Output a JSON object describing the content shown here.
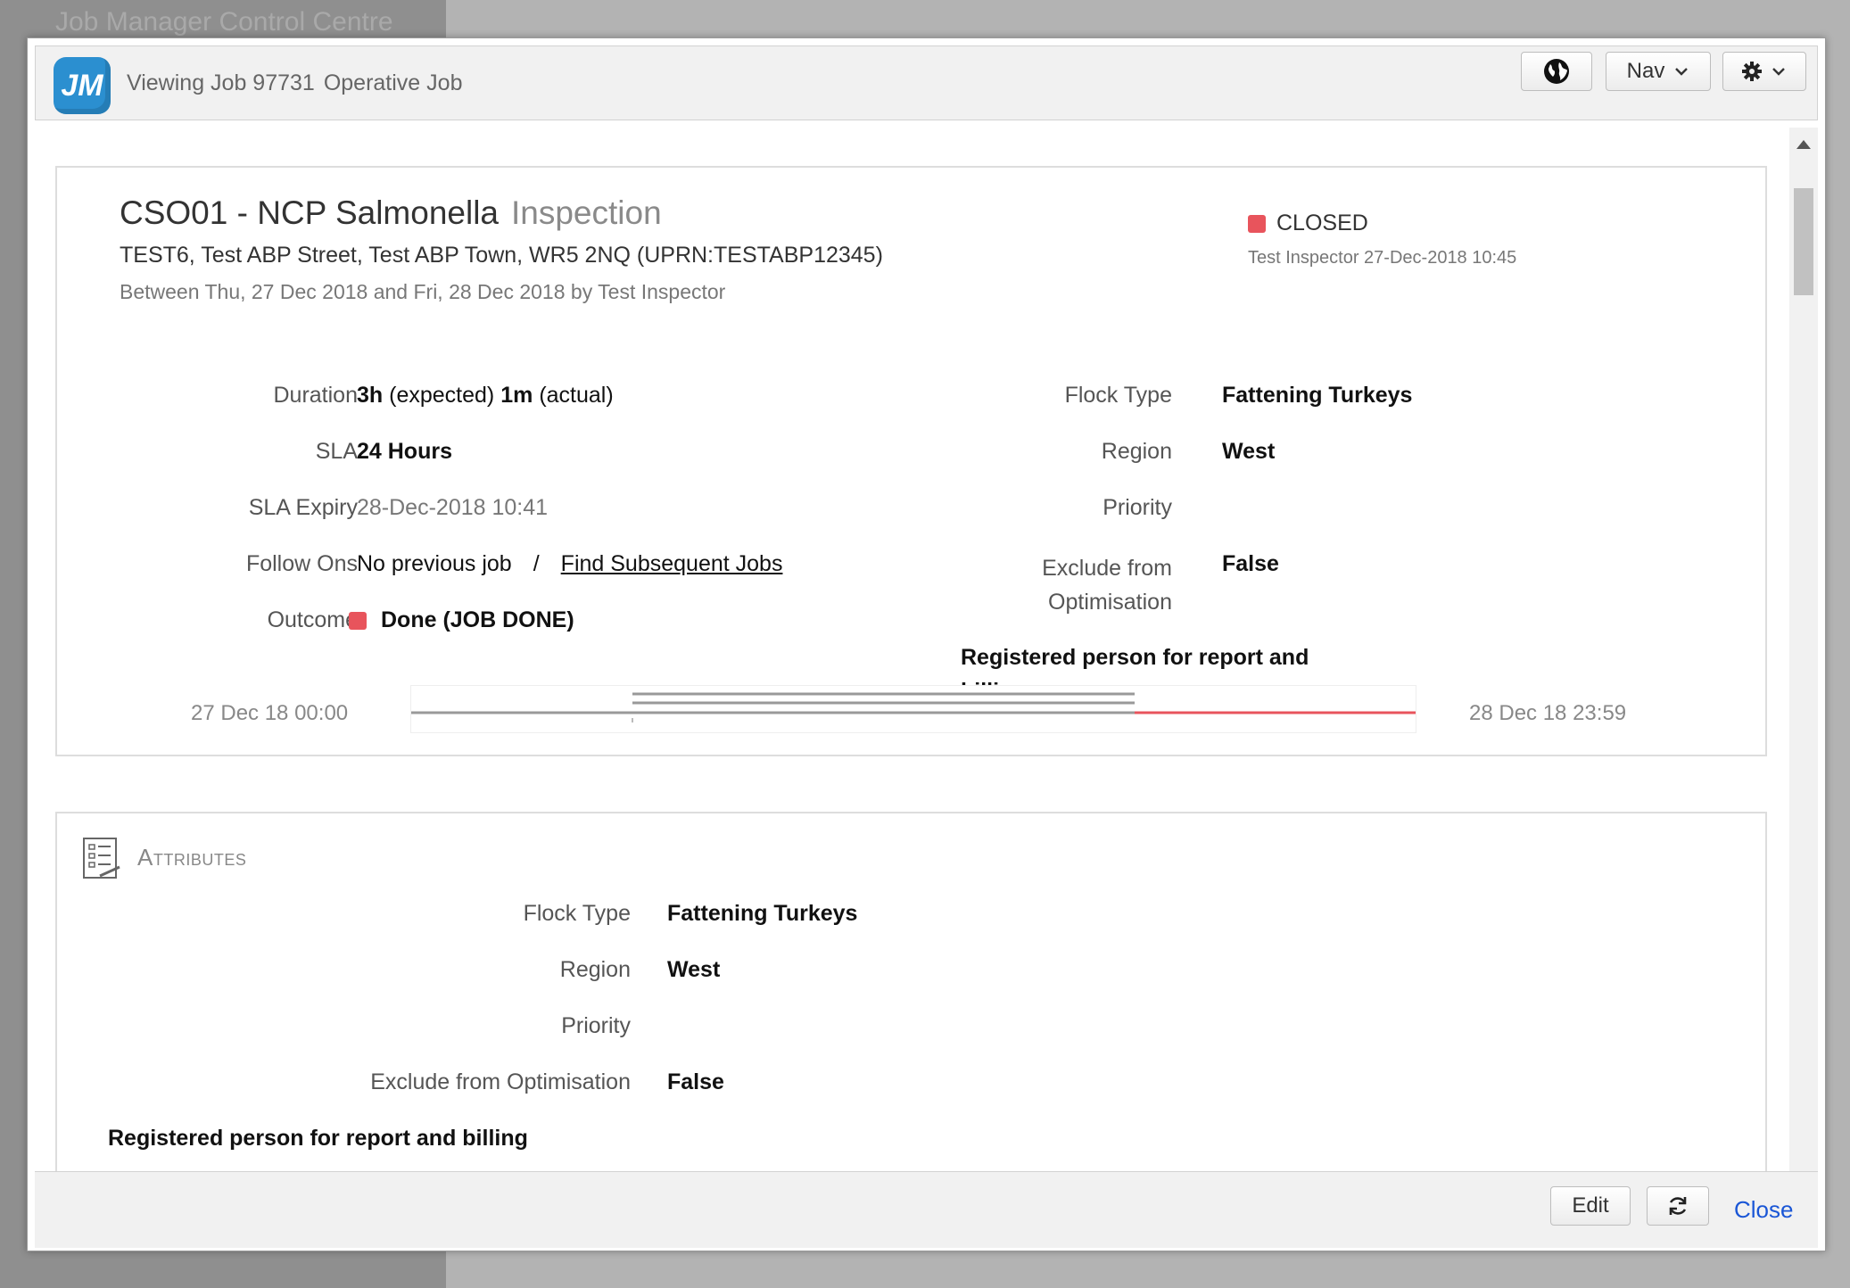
{
  "background": {
    "app_title": "Job Manager Control Centre"
  },
  "header": {
    "logo_text": "JM",
    "title": "Viewing Job 97731",
    "subtitle": "Operative Job",
    "nav_label": "Nav"
  },
  "job": {
    "code_name": "CSO01 - NCP Salmonella",
    "type": "Inspection",
    "address": "TEST6, Test ABP Street, Test ABP Town, WR5 2NQ (UPRN:TESTABP12345)",
    "schedule": "Between Thu, 27 Dec 2018 and Fri, 28 Dec 2018 by Test Inspector",
    "status": "CLOSED",
    "status_color": "#e8545c",
    "status_by": "Test Inspector 27-Dec-2018 10:45"
  },
  "details": {
    "duration_label": "Duration",
    "duration_expected": "3h",
    "duration_expected_suffix": "(expected)",
    "duration_actual": "1m",
    "duration_actual_suffix": "(actual)",
    "sla_label": "SLA",
    "sla_value": "24 Hours",
    "sla_expiry_label": "SLA Expiry",
    "sla_expiry_value": "28-Dec-2018 10:41",
    "follow_ons_label": "Follow Ons",
    "follow_ons_prev": "No previous job",
    "follow_ons_sep": "/",
    "follow_ons_link": "Find Subsequent Jobs",
    "outcome_label": "Outcome",
    "outcome_value": "Done (JOB DONE)",
    "flock_type_label": "Flock Type",
    "flock_type_value": "Fattening Turkeys",
    "region_label": "Region",
    "region_value": "West",
    "priority_label": "Priority",
    "exclude_label_line1": "Exclude from",
    "exclude_label_line2": "Optimisation",
    "exclude_value": "False",
    "registered_line1": "Registered person for report and",
    "registered_line2": "billing"
  },
  "timeline": {
    "start": "27 Dec 18 00:00",
    "end": "28 Dec 18 23:59",
    "actual_color": "#e8545c"
  },
  "attributes": {
    "heading": "Attributes",
    "rows": [
      {
        "label": "Flock Type",
        "value": "Fattening Turkeys"
      },
      {
        "label": "Region",
        "value": "West"
      },
      {
        "label": "Priority",
        "value": ""
      },
      {
        "label": "Exclude from Optimisation",
        "value": "False"
      }
    ],
    "registered": "Registered person for report and billing"
  },
  "footer": {
    "edit_label": "Edit",
    "close_label": "Close"
  }
}
